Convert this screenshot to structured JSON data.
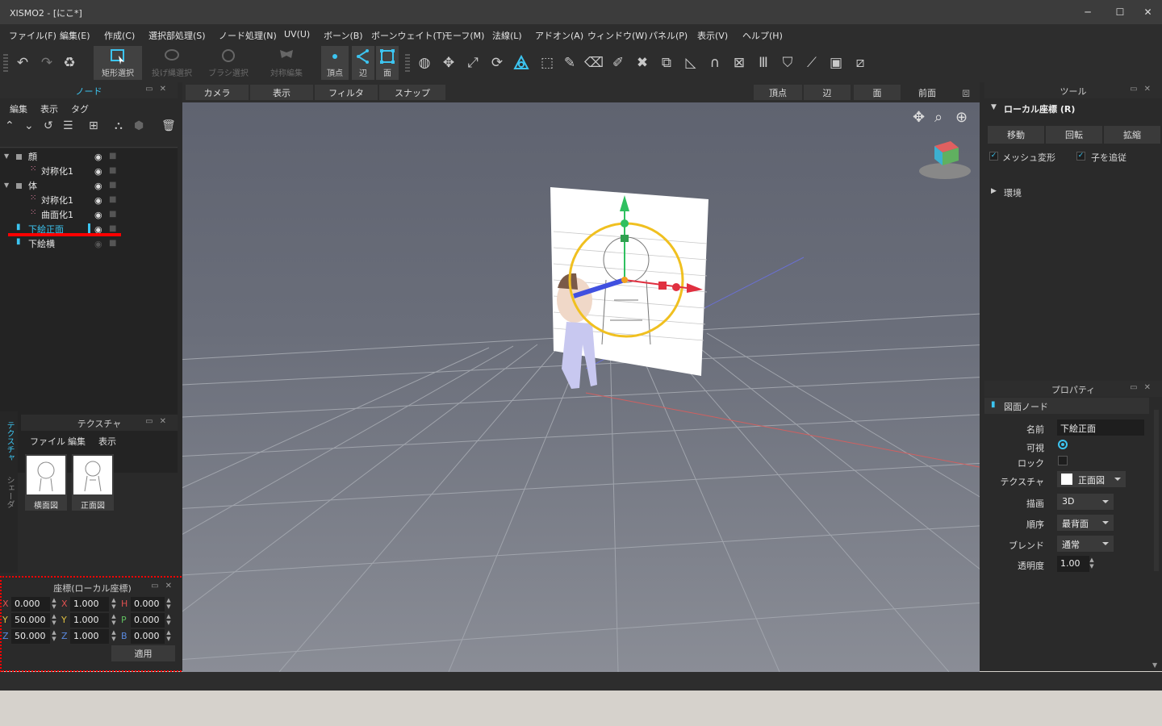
{
  "title": "XISMO2 - [にこ*]",
  "window_buttons": {
    "minimize": "─",
    "maximize": "☐",
    "close": "✕"
  },
  "menu": [
    "ファイル(F)",
    "編集(E)",
    "作成(C)",
    "選択部処理(S)",
    "ノード処理(N)",
    "UV(U)",
    "ボーン(B)",
    "ボーンウェイト(T)",
    "モーフ(M)",
    "法線(L)",
    "アドオン(A)",
    "ウィンドウ(W)",
    "パネル(P)",
    "表示(V)",
    "ヘルプ(H)"
  ],
  "toolbar": {
    "rect_select": "矩形選択",
    "lasso_select": "投げ縄選択",
    "brush_select": "ブラシ選択",
    "sym_edit": "対称編集",
    "vertex": "頂点",
    "edge": "辺",
    "face": "面"
  },
  "node_panel": {
    "title": "ノード",
    "menu": [
      "編集",
      "表示",
      "タグ"
    ],
    "items": [
      {
        "label": "顔",
        "level": 0,
        "type": "group"
      },
      {
        "label": "対称化1",
        "level": 1,
        "type": "mod"
      },
      {
        "label": "体",
        "level": 0,
        "type": "group"
      },
      {
        "label": "対称化1",
        "level": 1,
        "type": "mod"
      },
      {
        "label": "曲面化1",
        "level": 1,
        "type": "mod"
      },
      {
        "label": "下絵正面",
        "level": 0,
        "type": "image",
        "selected": true
      },
      {
        "label": "下絵横",
        "level": 0,
        "type": "image"
      }
    ]
  },
  "texture_panel": {
    "title": "テクスチャ",
    "menu": [
      "ファイル",
      "編集",
      "表示"
    ],
    "side_tabs": [
      "テクスチャ",
      "シェーダ"
    ],
    "thumbs": [
      "横面図",
      "正面図"
    ]
  },
  "coord_panel": {
    "title": "座標(ローカル座標)",
    "rows": [
      {
        "a": "X",
        "av": "0.000",
        "b": "X",
        "bv": "1.000",
        "c": "H",
        "cv": "0.000"
      },
      {
        "a": "Y",
        "av": "50.000",
        "b": "Y",
        "bv": "1.000",
        "c": "P",
        "cv": "0.000"
      },
      {
        "a": "Z",
        "av": "50.000",
        "b": "Z",
        "bv": "1.000",
        "c": "B",
        "cv": "0.000"
      }
    ],
    "apply": "適用"
  },
  "viewport_bar": {
    "camera": "カメラ",
    "display": "表示",
    "filter": "フィルタ",
    "snap": "スナップ",
    "vertex": "頂点",
    "edge": "辺",
    "face": "面",
    "view": "前面"
  },
  "tool_panel": {
    "title": "ツール",
    "section": "ローカル座標 (R)",
    "buttons": [
      "移動",
      "回転",
      "拡縮"
    ],
    "mesh_deform": "メッシュ変形",
    "follow_child": "子を追従",
    "env": "環境"
  },
  "prop_panel": {
    "title": "プロパティ",
    "node_type": "図面ノード",
    "name_label": "名前",
    "name_value": "下絵正面",
    "visible_label": "可視",
    "lock_label": "ロック",
    "texture_label": "テクスチャ",
    "texture_value": "正面図",
    "draw_label": "描画",
    "draw_value": "3D",
    "order_label": "順序",
    "order_value": "最背面",
    "blend_label": "ブレンド",
    "blend_value": "通常",
    "opacity_label": "透明度",
    "opacity_value": "1.00"
  },
  "colors": {
    "accent": "#3cc4f0",
    "highlight": "#ff0000"
  }
}
